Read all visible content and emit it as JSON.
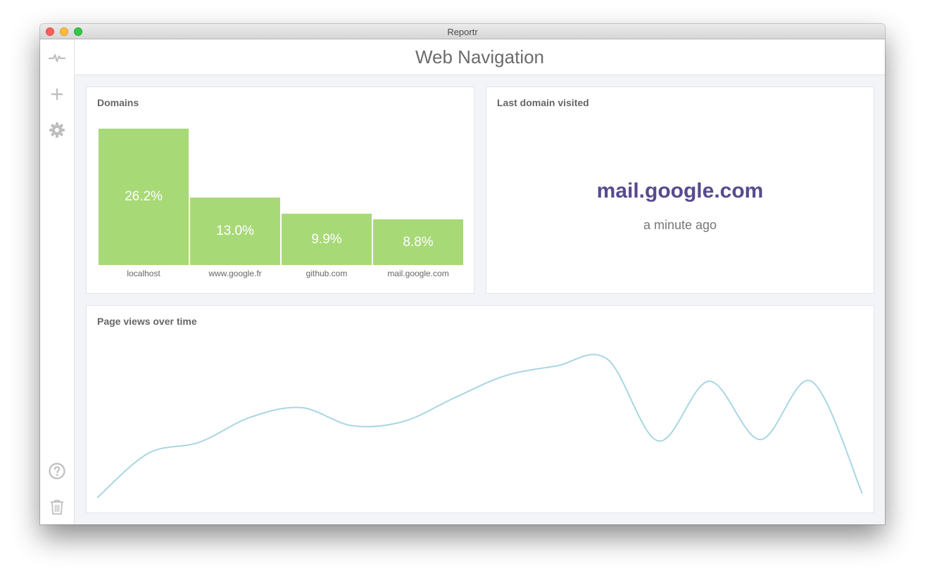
{
  "window": {
    "title": "Reportr"
  },
  "sidebar": {
    "icons": [
      "activity-icon",
      "add-icon",
      "gear-icon",
      "help-icon",
      "trash-icon"
    ]
  },
  "header": {
    "title": "Web Navigation"
  },
  "domains_card": {
    "title": "Domains",
    "bar_color": "#a8d977"
  },
  "last_domain_card": {
    "title": "Last domain visited",
    "domain": "mail.google.com",
    "time": "a minute ago",
    "domain_color": "#584a8e"
  },
  "views_card": {
    "title": "Page views over time",
    "line_color": "#a9d6e3"
  },
  "chart_data": [
    {
      "type": "bar",
      "title": "Domains",
      "categories": [
        "localhost",
        "www.google.fr",
        "github.com",
        "mail.google.com"
      ],
      "values": [
        26.2,
        13.0,
        9.9,
        8.8
      ],
      "labels": [
        "26.2%",
        "13.0%",
        "9.9%",
        "8.8%"
      ],
      "ylim": [
        0,
        26.2
      ]
    },
    {
      "type": "line",
      "title": "Page views over time",
      "x": [
        0,
        1,
        2,
        3,
        4,
        5,
        6,
        7,
        8,
        9,
        10,
        11,
        12,
        13,
        14,
        15
      ],
      "values": [
        2,
        34,
        42,
        60,
        67,
        54,
        57,
        74,
        90,
        97,
        102,
        43,
        86,
        44,
        86,
        5
      ],
      "ylim": [
        0,
        110
      ]
    }
  ]
}
